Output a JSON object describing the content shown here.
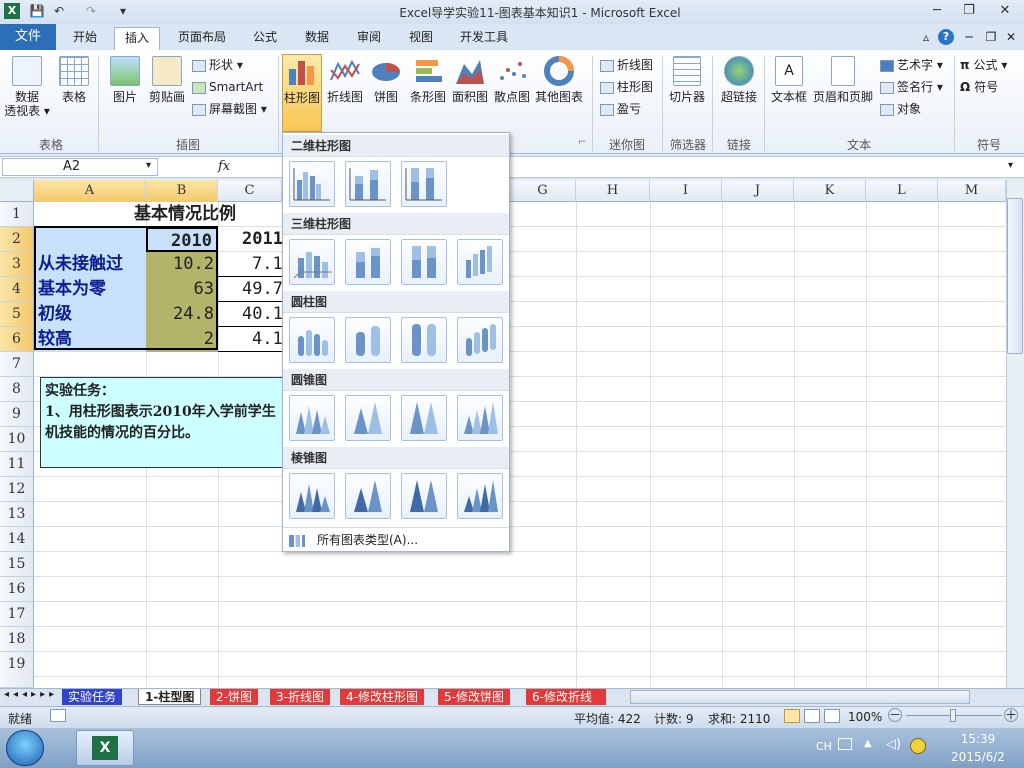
{
  "window": {
    "title": "Excel导学实验11-图表基本知识1 - Microsoft Excel"
  },
  "qat": {
    "save": "💾",
    "undo": "↶",
    "redo": "↷",
    "customize": "▾"
  },
  "window_controls": {
    "minimize": "─",
    "restore": "❐",
    "close": "✕"
  },
  "tabs": {
    "file": "文件",
    "home": "开始",
    "insert": "插入",
    "page_layout": "页面布局",
    "formulas": "公式",
    "data": "数据",
    "review": "审阅",
    "view": "视图",
    "developer": "开发工具"
  },
  "ribbon_controls": {
    "collapse": "▵",
    "help": "?",
    "min": "─",
    "restore": "❐",
    "close": "✕"
  },
  "ribbon": {
    "pivot": "数据\n透视表 ▾",
    "table": "表格",
    "picture": "图片",
    "clipart": "剪贴画",
    "shapes": "形状 ▾",
    "smartart": "SmartArt",
    "screenshot": "屏幕截图 ▾",
    "column": "柱形图",
    "line": "折线图",
    "pie": "饼图",
    "bar": "条形图",
    "area": "面积图",
    "scatter": "散点图",
    "other": "其他图表",
    "spark_line": "折线图",
    "spark_column": "柱形图",
    "spark_winloss": "盈亏",
    "slicer": "切片器",
    "hyperlink": "超链接",
    "textbox": "文本框",
    "header_footer": "页眉和页脚",
    "wordart": "艺术字 ▾",
    "signature": "签名行 ▾",
    "object": "对象",
    "equation": "公式 ▾",
    "symbol": "符号",
    "groups": {
      "tables": "表格",
      "illustrations": "插图",
      "sparklines": "迷你图",
      "filter": "筛选器",
      "links": "链接",
      "text": "文本",
      "symbols": "符号"
    }
  },
  "formula_bar": {
    "name_box": "A2",
    "fx": "fx",
    "value": ""
  },
  "columns": [
    "A",
    "B",
    "C",
    "G",
    "H",
    "I",
    "J",
    "K",
    "L",
    "M"
  ],
  "rows": [
    "1",
    "2",
    "3",
    "4",
    "5",
    "6",
    "7",
    "8",
    "9",
    "10",
    "11",
    "12",
    "13",
    "14",
    "15",
    "16",
    "17",
    "18",
    "19"
  ],
  "sheet": {
    "title": "基本情况比例",
    "year_2010": "2010",
    "year_2011": "2011",
    "labels": [
      "从未接触过",
      "基本为零",
      "初级",
      "较高"
    ],
    "values_2010": [
      "10.2",
      "63",
      "24.8",
      "2"
    ],
    "values_2011": [
      "7.1",
      "49.7",
      "40.1",
      "4.1"
    ],
    "note_line1": "实验任务：",
    "note_line2": "1、用柱形图表示2010年入学前学生",
    "note_line3": "机技能的情况的百分比。"
  },
  "dropdown": {
    "h1": "二维柱形图",
    "h2": "三维柱形图",
    "h3": "圆柱图",
    "h4": "圆锥图",
    "h5": "棱锥图",
    "all_types": "所有图表类型(A)..."
  },
  "sheet_tabs": [
    "实验任务",
    "1-柱型图",
    "2-饼图",
    "3-折线图",
    "4-修改柱形图",
    "5-修改饼图",
    "6-修改折线"
  ],
  "status": {
    "ready": "就绪",
    "average": "平均值: 422",
    "count": "计数: 9",
    "sum": "求和: 2110",
    "zoom": "100%",
    "zoom_minus": "－",
    "zoom_plus": "＋"
  },
  "taskbar": {
    "ime": "CH",
    "time": "15:39",
    "date": "2015/6/2"
  }
}
